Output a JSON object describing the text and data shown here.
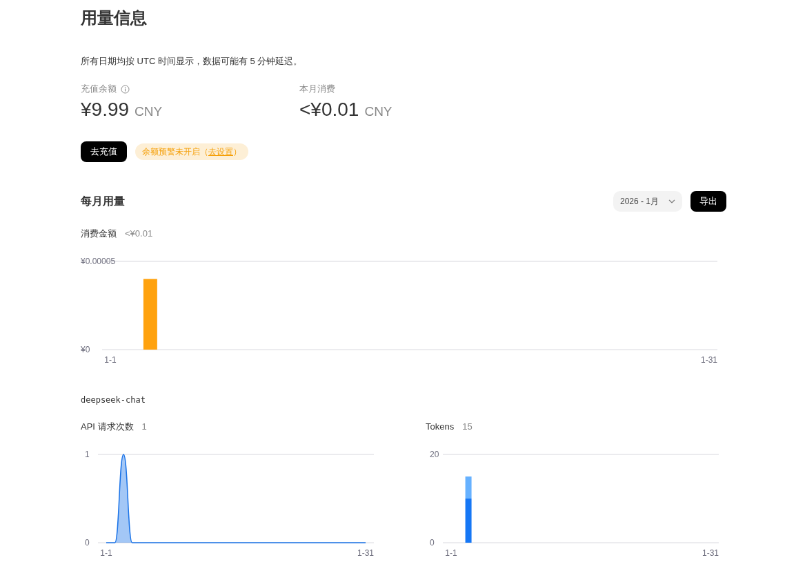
{
  "page": {
    "title": "用量信息",
    "notice": "所有日期均按 UTC 时间显示，数据可能有 5 分钟延迟。"
  },
  "balance": {
    "label": "充值余额",
    "amount": "¥9.99",
    "currency": "CNY"
  },
  "monthly_spend": {
    "label": "本月消费",
    "amount": "<¥0.01",
    "currency": "CNY"
  },
  "actions": {
    "topup_button": "去充值",
    "alert": {
      "text_before": "余额预警未开启（",
      "link": "去设置",
      "text_after": "）"
    }
  },
  "monthly_usage": {
    "title": "每月用量",
    "month_select": {
      "value": "2026 - 1月"
    },
    "export_button": "导出",
    "cost": {
      "label": "消费金额",
      "total": "<¥0.01",
      "chart_data": {
        "type": "bar",
        "categories": [
          "1-1",
          null,
          null,
          null,
          null,
          null,
          null,
          null,
          null,
          null,
          null,
          null,
          null,
          null,
          null,
          null,
          null,
          null,
          null,
          null,
          null,
          null,
          null,
          null,
          null,
          null,
          null,
          null,
          null,
          null,
          "1-31"
        ],
        "series": [
          {
            "color": "#ffa20e",
            "values": [
              0,
              0,
              4e-05,
              0,
              0,
              0,
              0,
              0,
              0,
              0,
              0,
              0,
              0,
              0,
              0,
              0,
              0,
              0,
              0,
              0,
              0,
              0,
              0,
              0,
              0,
              0,
              0,
              0,
              0,
              0,
              0
            ]
          }
        ],
        "ylim": [
          0,
          5e-05
        ],
        "yticks": [
          {
            "value": 0,
            "label": "¥0"
          },
          {
            "value": 5e-05,
            "label": "¥0.00005"
          }
        ]
      }
    },
    "model": "deepseek-chat",
    "requests": {
      "label": "API 请求次数",
      "total": "1",
      "chart_data": {
        "type": "area",
        "categories": [
          "1-1",
          null,
          null,
          null,
          null,
          null,
          null,
          null,
          null,
          null,
          null,
          null,
          null,
          null,
          null,
          null,
          null,
          null,
          null,
          null,
          null,
          null,
          null,
          null,
          null,
          null,
          null,
          null,
          null,
          null,
          "1-31"
        ],
        "series": [
          {
            "color": "#1a73e8",
            "values": [
              0,
              0,
              1,
              0,
              0,
              0,
              0,
              0,
              0,
              0,
              0,
              0,
              0,
              0,
              0,
              0,
              0,
              0,
              0,
              0,
              0,
              0,
              0,
              0,
              0,
              0,
              0,
              0,
              0,
              0,
              0
            ]
          }
        ],
        "ylim": [
          0,
          1
        ],
        "yticks": [
          {
            "value": 0,
            "label": "0"
          },
          {
            "value": 1,
            "label": "1"
          }
        ]
      }
    },
    "tokens": {
      "label": "Tokens",
      "total": "15",
      "chart_data": {
        "type": "bar",
        "stacked": true,
        "categories": [
          "1-1",
          null,
          null,
          null,
          null,
          null,
          null,
          null,
          null,
          null,
          null,
          null,
          null,
          null,
          null,
          null,
          null,
          null,
          null,
          null,
          null,
          null,
          null,
          null,
          null,
          null,
          null,
          null,
          null,
          null,
          "1-31"
        ],
        "series": [
          {
            "color": "#1677f5",
            "values": [
              0,
              0,
              10,
              0,
              0,
              0,
              0,
              0,
              0,
              0,
              0,
              0,
              0,
              0,
              0,
              0,
              0,
              0,
              0,
              0,
              0,
              0,
              0,
              0,
              0,
              0,
              0,
              0,
              0,
              0,
              0
            ]
          },
          {
            "color": "#66b1ff",
            "values": [
              0,
              0,
              5,
              0,
              0,
              0,
              0,
              0,
              0,
              0,
              0,
              0,
              0,
              0,
              0,
              0,
              0,
              0,
              0,
              0,
              0,
              0,
              0,
              0,
              0,
              0,
              0,
              0,
              0,
              0,
              0
            ]
          }
        ],
        "ylim": [
          0,
          20
        ],
        "yticks": [
          {
            "value": 0,
            "label": "0"
          },
          {
            "value": 20,
            "label": "20"
          }
        ]
      }
    }
  }
}
